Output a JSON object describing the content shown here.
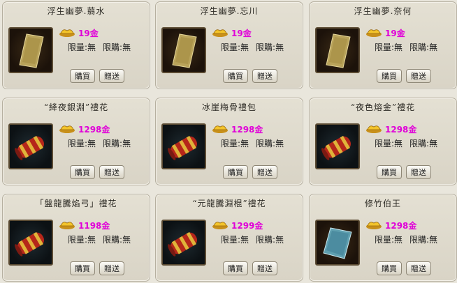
{
  "items": [
    {
      "name": "浮生幽夢.蒻水",
      "price": "19金",
      "limit_qty": "限量:無",
      "limit_buy": "限購:無",
      "buy": "購買",
      "gift": "贈送",
      "thumb": "scroll"
    },
    {
      "name": "浮生幽夢.忘川",
      "price": "19金",
      "limit_qty": "限量:無",
      "limit_buy": "限購:無",
      "buy": "購買",
      "gift": "贈送",
      "thumb": "scroll"
    },
    {
      "name": "浮生幽夢.奈何",
      "price": "19金",
      "limit_qty": "限量:無",
      "limit_buy": "限購:無",
      "buy": "購買",
      "gift": "贈送",
      "thumb": "scroll"
    },
    {
      "name": "“絳夜銀淵”禮花",
      "price": "1298金",
      "limit_qty": "限量:無",
      "limit_buy": "限購:無",
      "buy": "購買",
      "gift": "贈送",
      "thumb": "firework"
    },
    {
      "name": "冰崖梅骨禮包",
      "price": "1298金",
      "limit_qty": "限量:無",
      "limit_buy": "限購:無",
      "buy": "購買",
      "gift": "贈送",
      "thumb": "firework"
    },
    {
      "name": "“夜色熔金”禮花",
      "price": "1298金",
      "limit_qty": "限量:無",
      "limit_buy": "限購:無",
      "buy": "購買",
      "gift": "贈送",
      "thumb": "firework"
    },
    {
      "name": "「盤龍騰焰弓」禮花",
      "price": "1198金",
      "limit_qty": "限量:無",
      "limit_buy": "限購:無",
      "buy": "購買",
      "gift": "贈送",
      "thumb": "firework"
    },
    {
      "name": "“元龍騰淵棍”禮花",
      "price": "1299金",
      "limit_qty": "限量:無",
      "limit_buy": "限購:無",
      "buy": "購買",
      "gift": "贈送",
      "thumb": "firework"
    },
    {
      "name": "修竹伯王",
      "price": "1298金",
      "limit_qty": "限量:無",
      "limit_buy": "限購:無",
      "buy": "購買",
      "gift": "贈送",
      "thumb": "bluecloth"
    }
  ],
  "colors": {
    "price": "#e000d8",
    "card_bg": "#dcd7c9",
    "border": "#b6b0a0"
  },
  "icons": {
    "currency": "gold-ingot-icon"
  }
}
